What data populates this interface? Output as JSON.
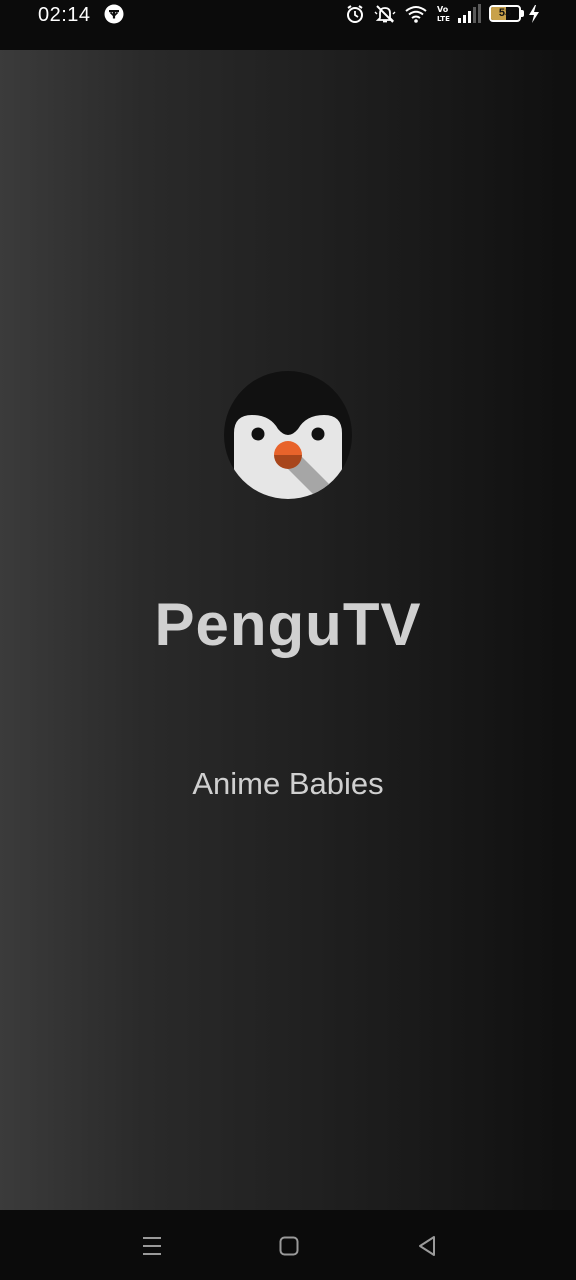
{
  "status_bar": {
    "time": "02:14",
    "battery_level": "53",
    "battery_fraction": 0.53,
    "icons": [
      "vpn-key-icon",
      "alarm-icon",
      "mute-icon",
      "wifi-icon",
      "volte-icon",
      "signal-icon",
      "battery-icon",
      "charging-icon"
    ]
  },
  "splash": {
    "title": "PenguTV",
    "subtitle": "Anime Babies",
    "logo_icon": "penguin-icon"
  },
  "nav_bar": {
    "icons": [
      "menu-icon",
      "home-icon",
      "back-icon"
    ]
  },
  "colors": {
    "background_dark": "#0b0b0b",
    "text_light": "#d0d0d0",
    "beak_orange": "#e8632b",
    "penguin_body": "#111111",
    "penguin_face": "#e6e6e6"
  }
}
